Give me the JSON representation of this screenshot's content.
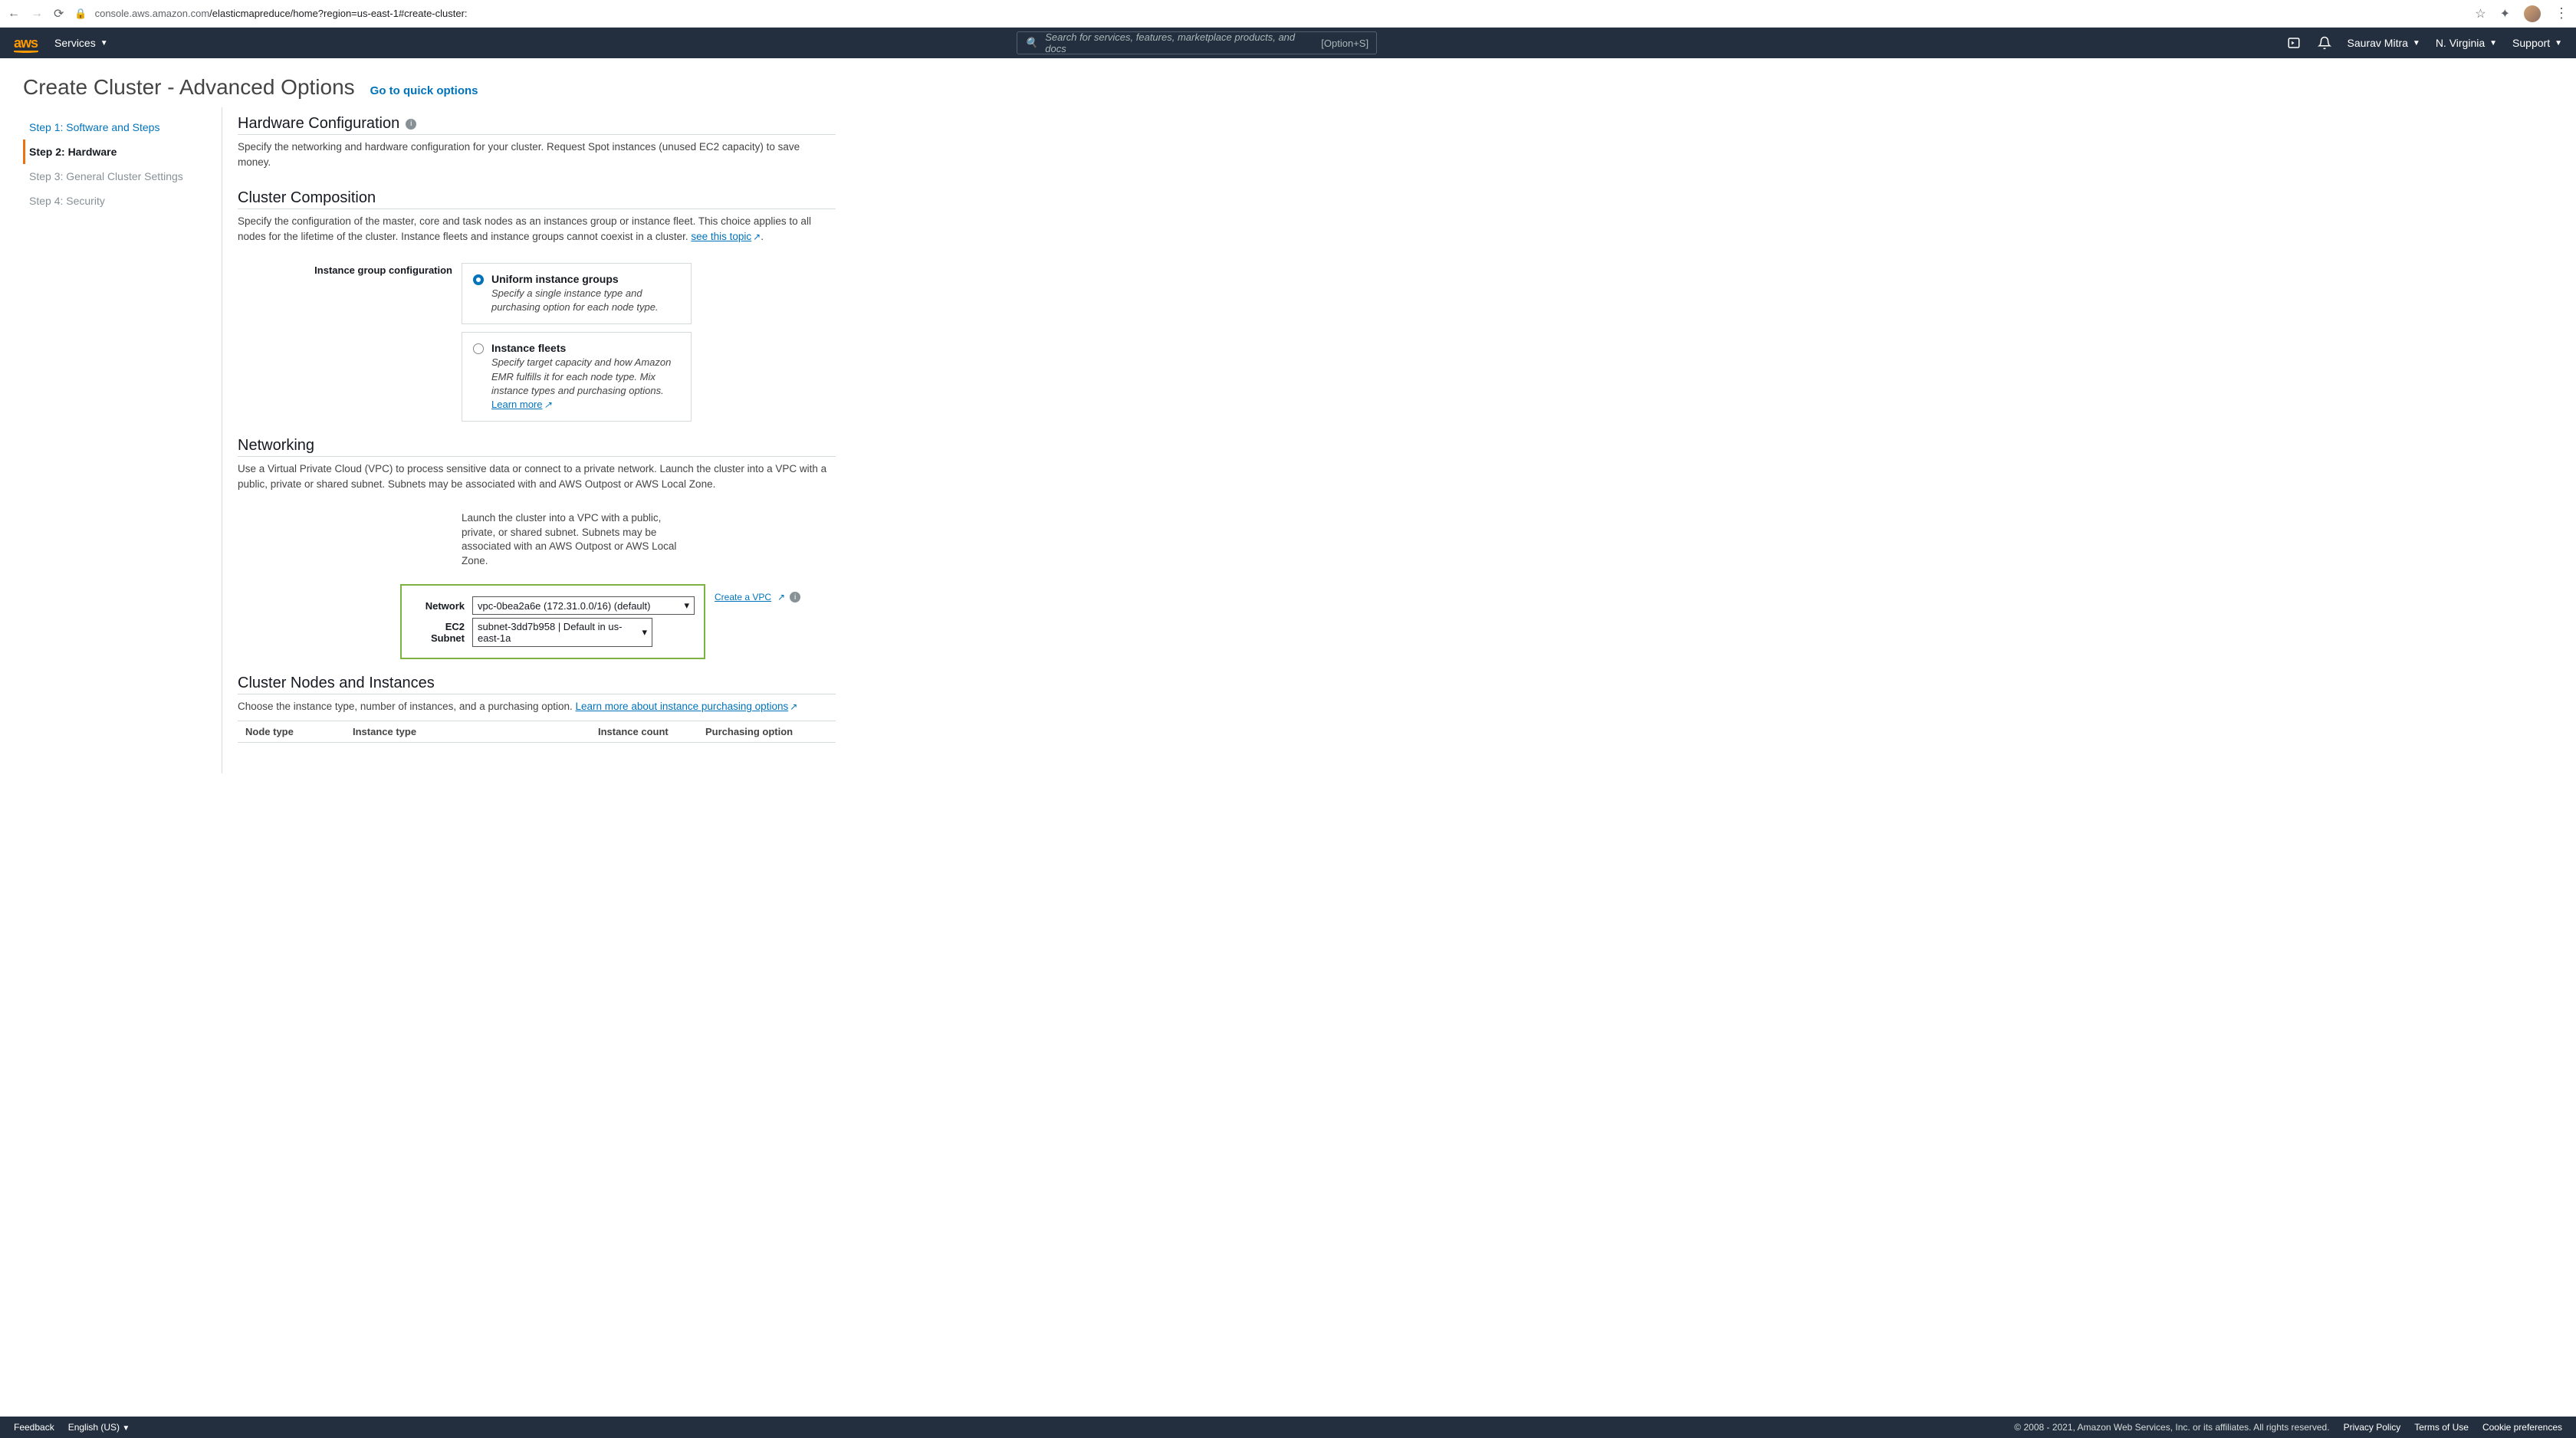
{
  "browser": {
    "url_host": "console.aws.amazon.com",
    "url_path": "/elasticmapreduce/home?region=us-east-1#create-cluster:"
  },
  "nav": {
    "services": "Services",
    "search_placeholder": "Search for services, features, marketplace products, and docs",
    "search_shortcut": "[Option+S]",
    "user": "Saurav Mitra",
    "region": "N. Virginia",
    "support": "Support"
  },
  "header": {
    "title": "Create Cluster - Advanced Options",
    "quick_link": "Go to quick options"
  },
  "steps": [
    {
      "label": "Step 1: Software and Steps",
      "state": "done"
    },
    {
      "label": "Step 2: Hardware",
      "state": "active"
    },
    {
      "label": "Step 3: General Cluster Settings",
      "state": "pending"
    },
    {
      "label": "Step 4: Security",
      "state": "pending"
    }
  ],
  "hardware": {
    "title": "Hardware Configuration",
    "desc": "Specify the networking and hardware configuration for your cluster. Request Spot instances (unused EC2 capacity) to save money."
  },
  "composition": {
    "title": "Cluster Composition",
    "desc_pre": "Specify the configuration of the master, core and task nodes as an instances group or instance fleet. This choice applies to all nodes for the lifetime of the cluster. Instance fleets and instance groups cannot coexist in a cluster. ",
    "link": "see this topic",
    "form_label": "Instance group configuration",
    "options": [
      {
        "title": "Uniform instance groups",
        "desc": "Specify a single instance type and purchasing option for each node type.",
        "selected": true
      },
      {
        "title": "Instance fleets",
        "desc": "Specify target capacity and how Amazon EMR fulfills it for each node type. Mix instance types and purchasing options. ",
        "learn_more": "Learn more",
        "selected": false
      }
    ]
  },
  "networking": {
    "title": "Networking",
    "desc": "Use a Virtual Private Cloud (VPC) to process sensitive data or connect to a private network. Launch the cluster into a VPC with a public, private or shared subnet. Subnets may be associated with and AWS Outpost or AWS Local Zone.",
    "narrow_desc": "Launch the cluster into a VPC with a public, private, or shared subnet. Subnets may be associated with an AWS Outpost or AWS Local Zone.",
    "network_label": "Network",
    "network_value": "vpc-0bea2a6e (172.31.0.0/16) (default)",
    "create_vpc": "Create a VPC",
    "subnet_label": "EC2 Subnet",
    "subnet_value": "subnet-3dd7b958 | Default in us-east-1a"
  },
  "nodes": {
    "title": "Cluster Nodes and Instances",
    "desc_pre": "Choose the instance type, number of instances, and a purchasing option. ",
    "link": "Learn more about instance purchasing options",
    "columns": [
      "Node type",
      "Instance type",
      "Instance count",
      "Purchasing option"
    ]
  },
  "footer": {
    "feedback": "Feedback",
    "language": "English (US)",
    "copyright": "© 2008 - 2021, Amazon Web Services, Inc. or its affiliates. All rights reserved.",
    "privacy": "Privacy Policy",
    "terms": "Terms of Use",
    "cookies": "Cookie preferences"
  }
}
